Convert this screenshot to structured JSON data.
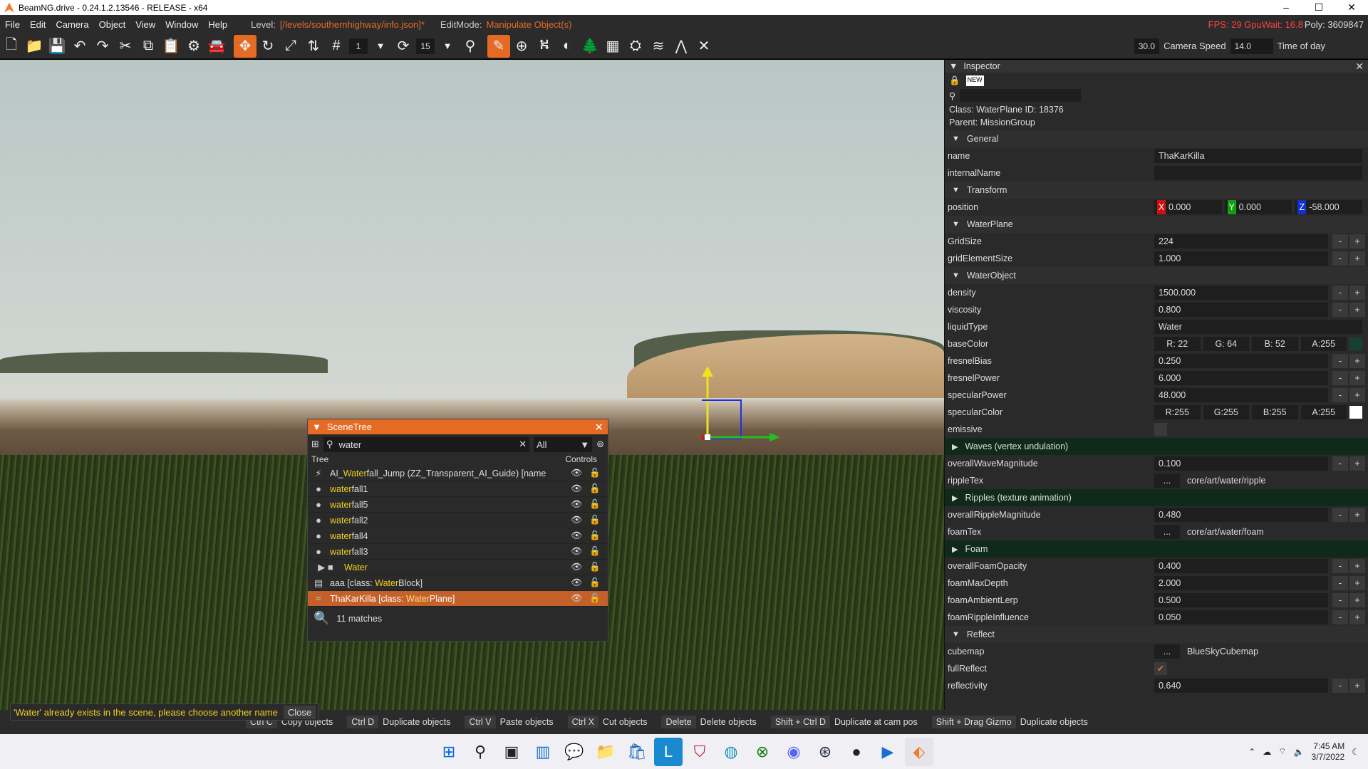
{
  "window": {
    "title": "BeamNG.drive - 0.24.1.2.13546 - RELEASE - x64",
    "controls": [
      "–",
      "☐",
      "✕"
    ]
  },
  "menu": {
    "items": [
      "File",
      "Edit",
      "Camera",
      "Object",
      "View",
      "Window",
      "Help"
    ],
    "level_label": "Level:",
    "level_value": "[/levels/southernhighway/info.json]*",
    "editmode_label": "EditMode:",
    "editmode_value": "Manipulate Object(s)",
    "fps": "FPS: 29  GpuWait: 16.8",
    "poly": "Poly: 3609847"
  },
  "toolbar": {
    "snap_value": "1",
    "rotate_value": "15",
    "camera_speed_value": "30.0",
    "camera_speed_label": "Camera Speed",
    "time_value": "14.0",
    "time_label": "Time of day"
  },
  "scenetree": {
    "title": "SceneTree",
    "search": "water",
    "filter": "All",
    "col_tree": "Tree",
    "col_controls": "Controls",
    "rows": [
      {
        "pre": "AI_",
        "hl": "Water",
        "post": "fall_Jump (ZZ_Transparent_AI_Guide) [name",
        "icon": "⚡"
      },
      {
        "pre": "",
        "hl": "water",
        "post": "fall1",
        "icon": "●"
      },
      {
        "pre": "",
        "hl": "water",
        "post": "fall5",
        "icon": "●"
      },
      {
        "pre": "",
        "hl": "water",
        "post": "fall2",
        "icon": "●"
      },
      {
        "pre": "",
        "hl": "water",
        "post": "fall4",
        "icon": "●"
      },
      {
        "pre": "",
        "hl": "water",
        "post": "fall3",
        "icon": "●"
      },
      {
        "pre": "",
        "hl": "Water",
        "post": "",
        "icon": "▶ ■"
      },
      {
        "pre": "aaa [class: ",
        "hl": "Water",
        "post": "Block]",
        "icon": "▤"
      },
      {
        "pre": "ThaKarKilla [class: ",
        "hl": "Water",
        "post": "Plane]",
        "icon": "≈"
      }
    ],
    "matches": "11 matches"
  },
  "inspector": {
    "title": "Inspector",
    "class_line": "Class: WaterPlane     ID: 18376",
    "parent_line": "Parent: MissionGroup",
    "s_general": "General",
    "s_transform": "Transform",
    "s_waterplane": "WaterPlane",
    "s_waterobject": "WaterObject",
    "s_waves": "Waves (vertex undulation)",
    "s_ripples": "Ripples (texture animation)",
    "s_foam": "Foam",
    "s_reflect": "Reflect",
    "name_k": "name",
    "name_v": "ThaKarKilla",
    "internal_k": "internalName",
    "internal_v": "",
    "pos_k": "position",
    "pos_x": "0.000",
    "pos_y": "0.000",
    "pos_z": "-58.000",
    "grid_k": "GridSize",
    "grid_v": "224",
    "gridel_k": "gridElementSize",
    "gridel_v": "1.000",
    "density_k": "density",
    "density_v": "1500.000",
    "visc_k": "viscosity",
    "visc_v": "0.800",
    "liquid_k": "liquidType",
    "liquid_v": "Water",
    "base_k": "baseColor",
    "base_r": "R: 22",
    "base_g": "G: 64",
    "base_b": "B: 52",
    "base_a": "A:255",
    "fbias_k": "fresnelBias",
    "fbias_v": "0.250",
    "fpow_k": "fresnelPower",
    "fpow_v": "6.000",
    "specp_k": "specularPower",
    "specp_v": "48.000",
    "specc_k": "specularColor",
    "specc_r": "R:255",
    "specc_g": "G:255",
    "specc_b": "B:255",
    "specc_a": "A:255",
    "emissive_k": "emissive",
    "owm_k": "overallWaveMagnitude",
    "owm_v": "0.100",
    "ripple_k": "rippleTex",
    "ripple_v": "core/art/water/ripple",
    "orm_k": "overallRippleMagnitude",
    "orm_v": "0.480",
    "foamtex_k": "foamTex",
    "foamtex_v": "core/art/water/foam",
    "ofo_k": "overallFoamOpacity",
    "ofo_v": "0.400",
    "fmd_k": "foamMaxDepth",
    "fmd_v": "2.000",
    "fal_k": "foamAmbientLerp",
    "fal_v": "0.500",
    "fri_k": "foamRippleInfluence",
    "fri_v": "0.050",
    "cube_k": "cubemap",
    "cube_v": "BlueSkyCubemap",
    "full_k": "fullReflect",
    "refl_k": "reflectivity",
    "refl_v": "0.640",
    "dots": "...",
    "minus": "-",
    "plus": "+",
    "colors": {
      "base": "#164034",
      "spec": "#ffffff"
    }
  },
  "toast": {
    "message": "'Water' already exists in the scene, please choose another name",
    "close": "Close"
  },
  "hints": [
    {
      "key": "Ctrl C",
      "action": "Copy objects"
    },
    {
      "key": "Ctrl D",
      "action": "Duplicate objects"
    },
    {
      "key": "Ctrl V",
      "action": "Paste objects"
    },
    {
      "key": "Ctrl X",
      "action": "Cut objects"
    },
    {
      "key": "Delete",
      "action": "Delete objects"
    },
    {
      "key": "Shift + Ctrl D",
      "action": "Duplicate at cam pos"
    },
    {
      "key": "Shift + Drag Gizmo",
      "action": "Duplicate objects"
    }
  ],
  "clock": {
    "time": "7:45 AM",
    "date": "3/7/2022"
  }
}
